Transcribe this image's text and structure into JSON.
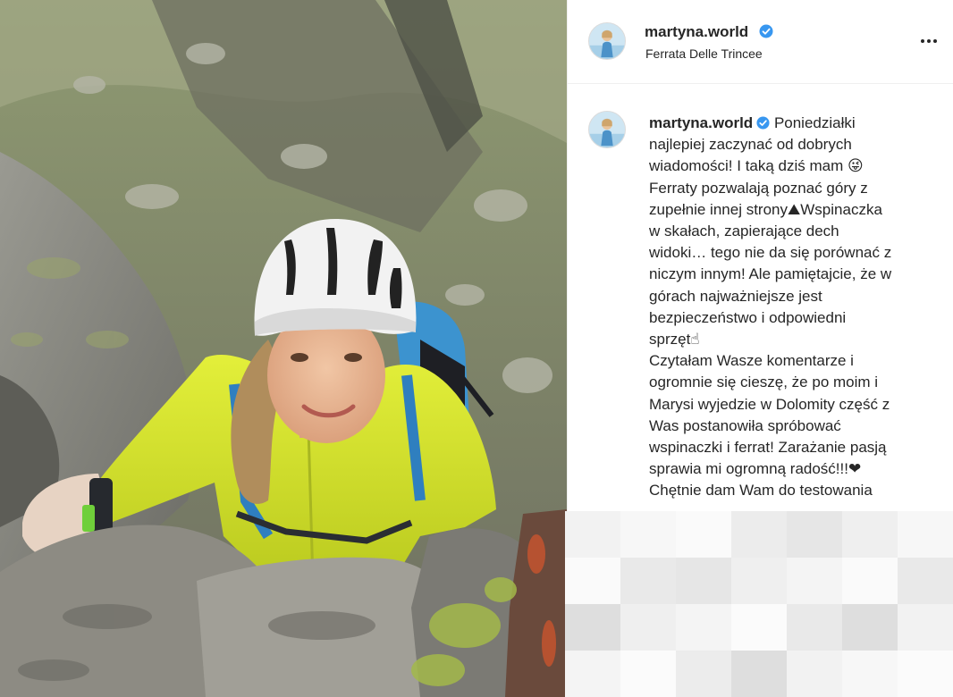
{
  "post": {
    "username": "martyna.world",
    "verified": true,
    "location": "Ferrata Delle Trincee",
    "photo_subject": "climber-with-helmet"
  },
  "caption": {
    "username": "martyna.world",
    "lines": [
      "Poniedziałki",
      "najlepiej zaczynać od dobrych",
      "wiadomości! I taką dziś mam 😜",
      "Ferraty pozwalają poznać góry z",
      "zupełnie innej strony⛰Wspinaczka",
      "w skałach, zapierające dech",
      "widoki… tego nie da się porównać z",
      "niczym innym! Ale pamiętajcie, że w",
      "górach najważniejsze jest",
      "bezpieczeństwo i odpowiedni",
      "sprzęt☝",
      "Czytałam Wasze komentarze i",
      "ogromnie się cieszę, że po moim i",
      "Marysi wyjedzie w Dolomity część z",
      "Was postanowiła spróbować",
      "wspinaczki i ferrat! Zarażanie pasją",
      "sprawia mi ogromną radość!!!❤",
      "Chętnie dam Wam do testowania"
    ]
  },
  "icons": {
    "verified_badge": "verified-check-icon",
    "more": "more-options-icon"
  },
  "colors": {
    "verified_blue": "#3897f0",
    "jacket": "#d8e82a",
    "helmet": "#f2f2f2"
  }
}
